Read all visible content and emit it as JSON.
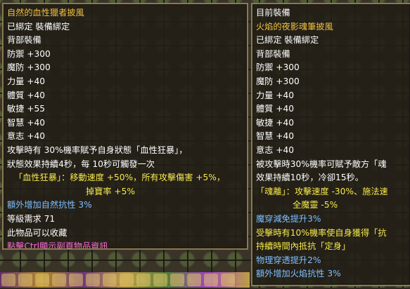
{
  "left_tooltip": {
    "title": "自然的血性獵者披風",
    "bind_status": "已綁定 裝備綁定",
    "slot": "背部裝備",
    "stats": [
      "防禦 +300",
      "魔防 +300",
      "力量 +40",
      "體質 +40",
      "敏捷 +55",
      "智慧 +40",
      "意志 +40"
    ],
    "effect_line1": "攻擊時有 30%機率賦予自身狀態「血性狂暴」，",
    "effect_line2": "狀態效果持續4秒，每 10秒可觸發一次",
    "effect_line3": "「血性狂暴」：移動速度 +50%，所有攻擊傷害 +5%，",
    "effect_line4": "掉寶率 +5%",
    "bonus_resist": "額外增加自然抗性 3%",
    "level_req": "等級需求 71",
    "collectible": "此物品可以收藏",
    "ctrl_hint": "點擊Ctrl顯示副頁物品資訊"
  },
  "right_tooltip": {
    "header": "目前裝備",
    "title": "火焰的夜影魂筆披風",
    "bind_status": "已綁定 裝備綁定",
    "slot": "背部裝備",
    "stats": [
      "防禦 +300",
      "魔防 +300",
      "力量 +40",
      "體質 +40",
      "敏捷 +40",
      "智慧 +40",
      "意志 +40"
    ],
    "effect_line1": "被攻擊時30%機率可賦予敵方「魂",
    "effect_line2": "效果持續10秒，冷卻15秒。",
    "effect_line3": "「魂離」：攻擊速度 -30%、施法速",
    "effect_line4": "全魔靈 -5%",
    "bonus_pierce_reduce": "魔穿減免提升3%",
    "effect_line5": "受擊時有10%機率使自身獲得「抗",
    "effect_line6": "持續時間內抵抗「定身」",
    "bonus_phys_pierce": "物理穿透提升2%",
    "bonus_fire_resist": "額外增加火焰抗性 3%"
  }
}
